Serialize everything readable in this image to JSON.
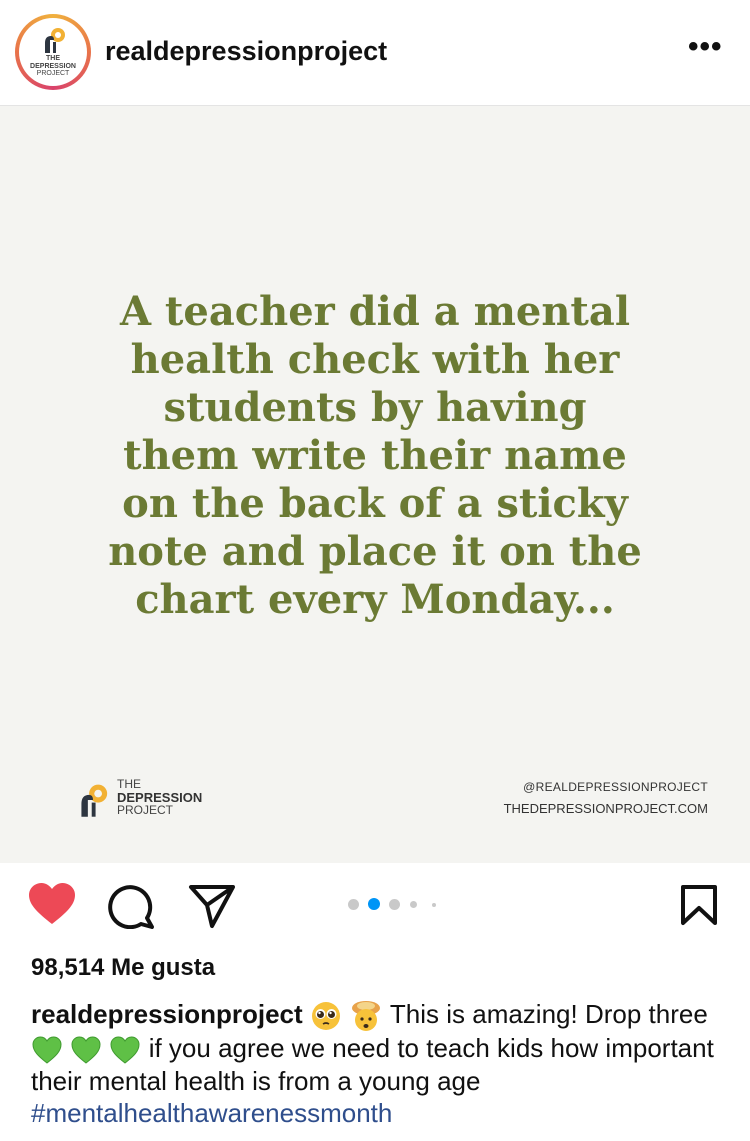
{
  "header": {
    "username": "realdepressionproject",
    "more_icon": "more-horizontal-icon"
  },
  "avatar": {
    "line1": "THE",
    "line2": "DEPRESSION",
    "line3": "PROJECT"
  },
  "post": {
    "quote": "A teacher did a mental health check with her students by having them write their name on the back of a sticky note and place it on the chart every Monday...",
    "brand_line1": "THE",
    "brand_line2": "DEPRESSION",
    "brand_line3": "PROJECT",
    "handle": "@REALDEPRESSIONPROJECT",
    "website": "THEDEPRESSIONPROJECT.COM",
    "quote_color": "#6b7a34",
    "background_color": "#f4f4f1"
  },
  "actions": {
    "like_icon": "heart-filled-icon",
    "comment_icon": "comment-icon",
    "share_icon": "send-icon",
    "save_icon": "bookmark-icon",
    "like_color": "#ed4956",
    "carousel_active_index": 1,
    "carousel_dot_count": 5
  },
  "likes": {
    "text": "98,514 Me gusta"
  },
  "caption": {
    "username": "realdepressionproject",
    "text_part1": "This is amazing! Drop three",
    "text_part2": "if you agree we need to teach kids how important their mental health is from a young age",
    "hashtag": "#mentalhealthawarenessmonth",
    "emojis_1": [
      "pleading-face",
      "exploding-head"
    ],
    "emojis_2": [
      "green-heart",
      "green-heart",
      "green-heart"
    ]
  }
}
